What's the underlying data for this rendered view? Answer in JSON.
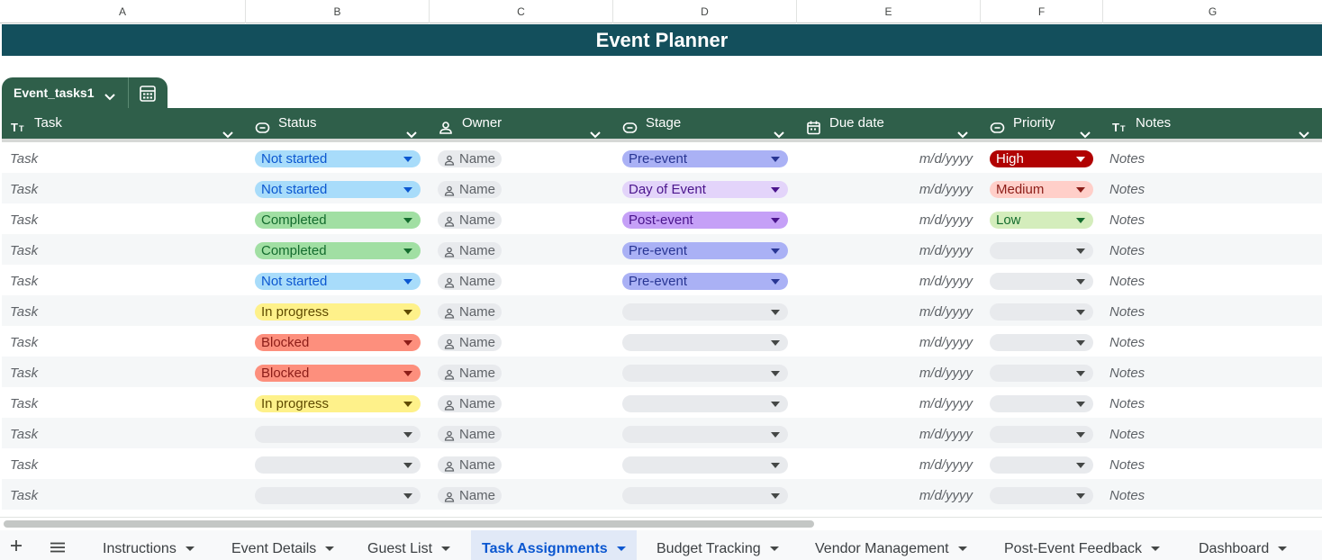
{
  "column_letters": [
    "A",
    "B",
    "C",
    "D",
    "E",
    "F",
    "G"
  ],
  "title": "Event Planner",
  "table": {
    "name": "Event_tasks1",
    "headers": {
      "task": "Task",
      "status": "Status",
      "owner": "Owner",
      "stage": "Stage",
      "due_date": "Due date",
      "priority": "Priority",
      "notes": "Notes"
    },
    "rows": [
      {
        "task": "Task",
        "status": "Not started",
        "owner": "Name",
        "stage": "Pre-event",
        "due": "m/d/yyyy",
        "priority": "High",
        "notes": "Notes"
      },
      {
        "task": "Task",
        "status": "Not started",
        "owner": "Name",
        "stage": "Day of Event",
        "due": "m/d/yyyy",
        "priority": "Medium",
        "notes": "Notes"
      },
      {
        "task": "Task",
        "status": "Completed",
        "owner": "Name",
        "stage": "Post-event",
        "due": "m/d/yyyy",
        "priority": "Low",
        "notes": "Notes"
      },
      {
        "task": "Task",
        "status": "Completed",
        "owner": "Name",
        "stage": "Pre-event",
        "due": "m/d/yyyy",
        "priority": "",
        "notes": "Notes"
      },
      {
        "task": "Task",
        "status": "Not started",
        "owner": "Name",
        "stage": "Pre-event",
        "due": "m/d/yyyy",
        "priority": "",
        "notes": "Notes"
      },
      {
        "task": "Task",
        "status": "In progress",
        "owner": "Name",
        "stage": "",
        "due": "m/d/yyyy",
        "priority": "",
        "notes": "Notes"
      },
      {
        "task": "Task",
        "status": "Blocked",
        "owner": "Name",
        "stage": "",
        "due": "m/d/yyyy",
        "priority": "",
        "notes": "Notes"
      },
      {
        "task": "Task",
        "status": "Blocked",
        "owner": "Name",
        "stage": "",
        "due": "m/d/yyyy",
        "priority": "",
        "notes": "Notes"
      },
      {
        "task": "Task",
        "status": "In progress",
        "owner": "Name",
        "stage": "",
        "due": "m/d/yyyy",
        "priority": "",
        "notes": "Notes"
      },
      {
        "task": "Task",
        "status": "",
        "owner": "Name",
        "stage": "",
        "due": "m/d/yyyy",
        "priority": "",
        "notes": "Notes"
      },
      {
        "task": "Task",
        "status": "",
        "owner": "Name",
        "stage": "",
        "due": "m/d/yyyy",
        "priority": "",
        "notes": "Notes"
      },
      {
        "task": "Task",
        "status": "",
        "owner": "Name",
        "stage": "",
        "due": "m/d/yyyy",
        "priority": "",
        "notes": "Notes"
      }
    ]
  },
  "chip_colors": {
    "": {
      "bg": "#e8eaed",
      "fg": "#1f1f1f"
    },
    "Not started": {
      "bg": "#a8dcfa",
      "fg": "#0b57d0"
    },
    "Completed": {
      "bg": "#a1dfa3",
      "fg": "#146c2e"
    },
    "In progress": {
      "bg": "#fef18a",
      "fg": "#5f4b00"
    },
    "Blocked": {
      "bg": "#fd8f7d",
      "fg": "#8c1d18"
    },
    "Pre-event": {
      "bg": "#aab1f5",
      "fg": "#283593"
    },
    "Day of Event": {
      "bg": "#e3d4fa",
      "fg": "#4a148c"
    },
    "Post-event": {
      "bg": "#c5a0f7",
      "fg": "#4a148c"
    },
    "High": {
      "bg": "#b10202",
      "fg": "#ffffff"
    },
    "Medium": {
      "bg": "#ffcfc9",
      "fg": "#8c1d18"
    },
    "Low": {
      "bg": "#d4edbc",
      "fg": "#146c2e"
    }
  },
  "theme": {
    "banner": "#134f5c",
    "table_header": "#2f5f4a"
  },
  "sheet_tabs": [
    {
      "label": "Instructions",
      "active": false
    },
    {
      "label": "Event Details",
      "active": false
    },
    {
      "label": "Guest List",
      "active": false
    },
    {
      "label": "Task Assignments",
      "active": true
    },
    {
      "label": "Budget Tracking",
      "active": false
    },
    {
      "label": "Vendor Management",
      "active": false
    },
    {
      "label": "Post-Event Feedback",
      "active": false
    },
    {
      "label": "Dashboard",
      "active": false
    }
  ],
  "icons": {
    "add_sheet": "plus-icon",
    "all_sheets": "menu-icon",
    "text_column": "text-type-icon",
    "dropdown_column": "dropdown-chip-icon",
    "person_column": "person-icon",
    "date_column": "calendar-icon",
    "table_calc": "table-calc-icon"
  }
}
